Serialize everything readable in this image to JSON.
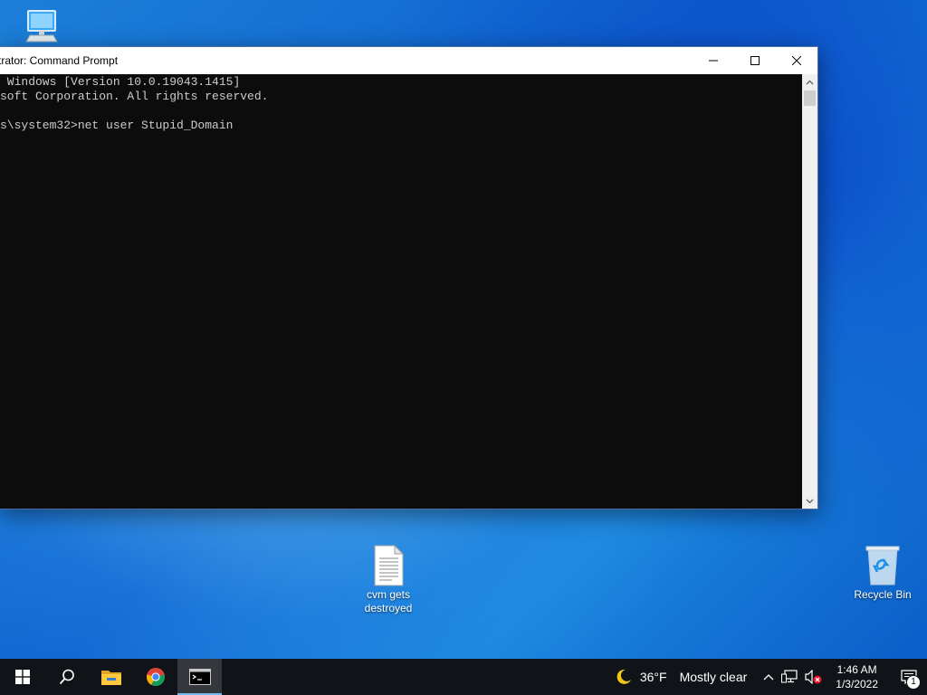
{
  "desktop": {
    "icons": [
      {
        "label": ""
      },
      {
        "label": "cvm gets destroyed"
      },
      {
        "label": "Recycle Bin"
      }
    ]
  },
  "cmd_window": {
    "title": "trator: Command Prompt",
    "lines": [
      " Windows [Version 10.0.19043.1415]",
      "soft Corporation. All rights reserved.",
      "",
      "s\\system32>net user Stupid_Domain"
    ]
  },
  "taskbar": {
    "apps": [
      "start",
      "search",
      "file-explorer",
      "chrome",
      "command-prompt"
    ],
    "active_app": "command-prompt",
    "weather": {
      "temp": "36°F",
      "condition": "Mostly clear"
    },
    "clock": {
      "time": "1:46 AM",
      "date": "1/3/2022"
    },
    "notifications": {
      "count": "1"
    }
  },
  "colors": {
    "console_bg": "#0c0c0c",
    "console_text": "#cccccc",
    "taskbar_bg": "#101419",
    "active_indicator": "#76b9ed"
  }
}
